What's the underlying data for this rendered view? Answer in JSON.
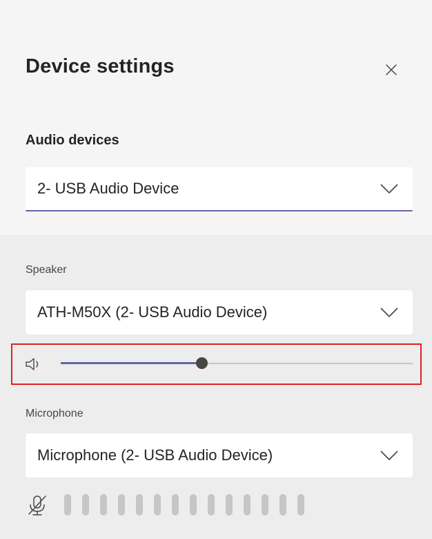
{
  "panel": {
    "title": "Device settings",
    "close_icon": "close-icon"
  },
  "audio_devices": {
    "label": "Audio devices",
    "selected": "2- USB Audio Device",
    "chevron_icon": "chevron-down-icon"
  },
  "speaker": {
    "label": "Speaker",
    "selected": "ATH-M50X (2- USB Audio Device)",
    "chevron_icon": "chevron-down-icon",
    "volume_icon": "speaker-icon",
    "volume_fraction": 0.4
  },
  "microphone": {
    "label": "Microphone",
    "selected": "Microphone (2- USB Audio Device)",
    "chevron_icon": "chevron-down-icon",
    "mic_icon": "microphone-muted-icon",
    "level_bar_count": 14,
    "level_active_bars": 0
  },
  "colors": {
    "accent": "#6264a7",
    "highlight_border": "#e02020",
    "meter_inactive": "#c8c6c4"
  }
}
